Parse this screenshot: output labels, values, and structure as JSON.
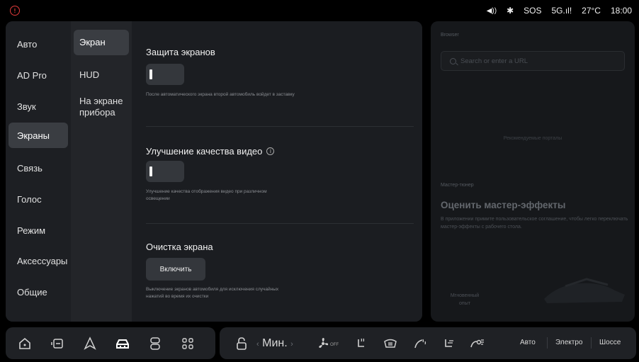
{
  "status": {
    "volume_icon": "volume-icon",
    "bluetooth_icon": "bluetooth-icon",
    "sos": "SOS",
    "network": "5G",
    "temperature": "27°C",
    "time": "18:00"
  },
  "categories": [
    "Авто",
    "AD Pro",
    "Звук",
    "Экраны",
    "Связь",
    "Голос",
    "Режим",
    "Аксессуары",
    "Общие"
  ],
  "active_category": "Экраны",
  "subcategories": [
    "Экран",
    "HUD",
    "На экране прибора"
  ],
  "active_subcategory": "Экран",
  "sections": {
    "screensaver": {
      "title": "Защита экранов",
      "desc": "После автоматического экрана второй автомобиль войдет в заставку",
      "toggle_on": false
    },
    "video": {
      "title": "Улучшение качества видео",
      "desc": "Улучшение качества отображения видео при различном освещении",
      "toggle_on": false
    },
    "clean": {
      "title": "Очистка экрана",
      "button": "Включить",
      "desc": "Выключение экранов автомобиля для исключения случайных нажатий во время их очистки"
    }
  },
  "right_panel": {
    "browser_label": "Browser",
    "search_placeholder": "Search or enter a URL",
    "browser_center": "Рекомендуемые порталы",
    "tuner_label": "Мастер-тюнер",
    "tuner_title": "Оценить мастер-эффекты",
    "tuner_desc": "В приложении примите пользовательское соглашение, чтобы легко переключать мастер-эффекты с рабочего стола.",
    "instant_label": "Мгновенный опыт"
  },
  "dock": {
    "temperature_label": "Мин.",
    "fan_label": "OFF",
    "modes": [
      "Авто",
      "Электро",
      "Шоссе"
    ]
  },
  "colors": {
    "brake_warning": "#e23b3b",
    "active_bg": "#3a3d42",
    "panel_bg": "#1d1f23"
  }
}
